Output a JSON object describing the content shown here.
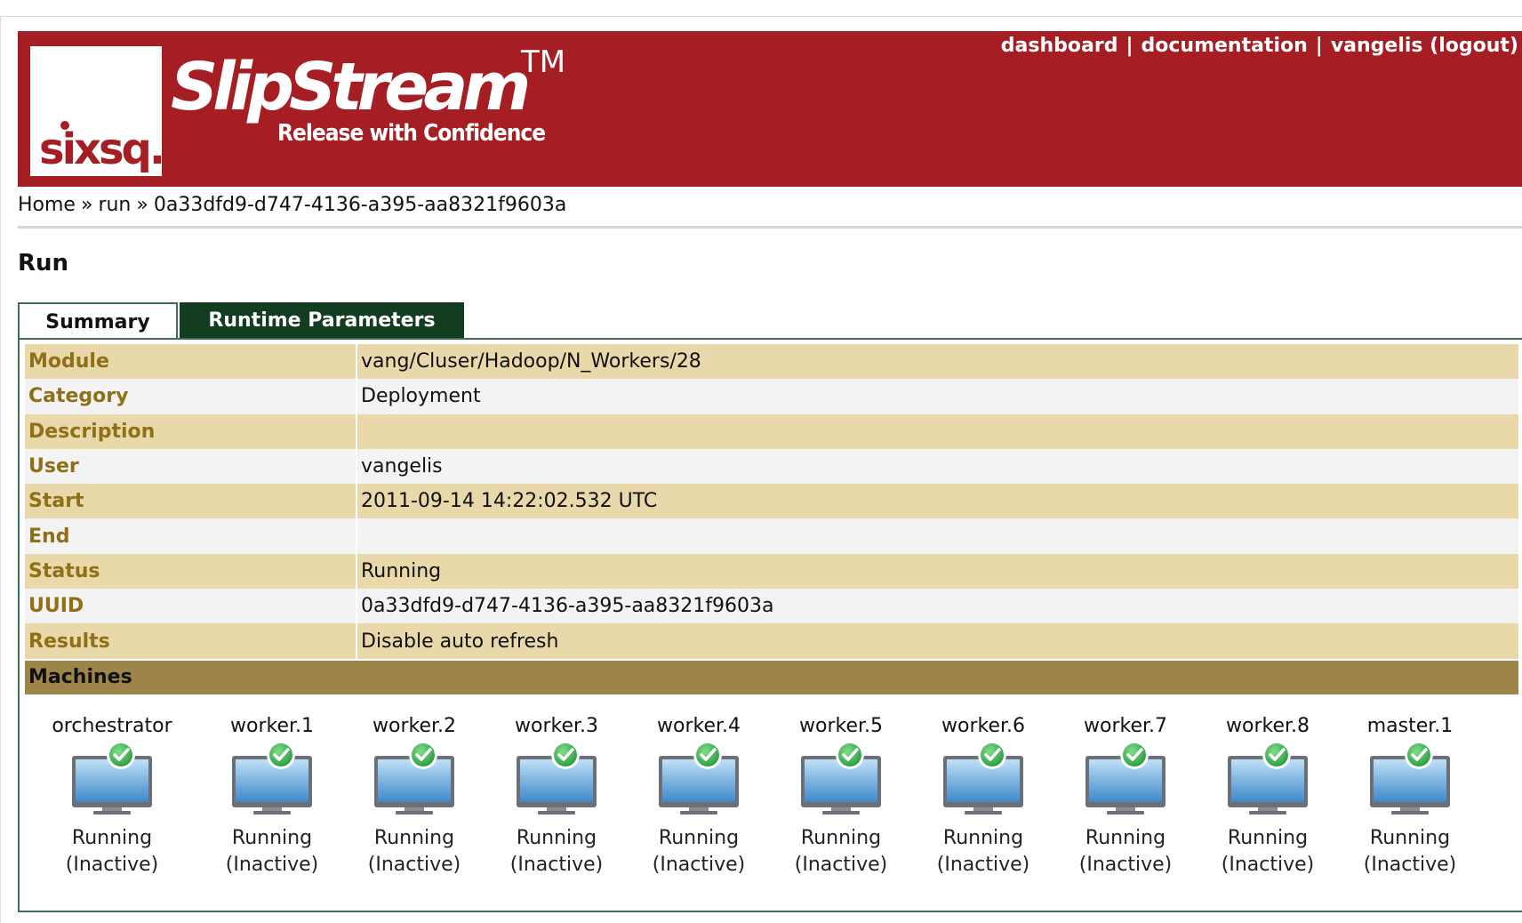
{
  "header": {
    "logo_text": "sixsq.",
    "brand": "SlipStream",
    "trademark": "TM",
    "tagline": "Release with Confidence",
    "nav": {
      "dashboard": "dashboard",
      "separator": "|",
      "documentation": "documentation",
      "user": "vangelis (logout)"
    }
  },
  "breadcrumb": {
    "home": "Home",
    "separator": "»",
    "run": "run",
    "current": "0a33dfd9-d747-4136-a395-aa8321f9603a"
  },
  "page_title": "Run",
  "tabs": {
    "summary": "Summary",
    "runtime": "Runtime Parameters"
  },
  "summary": {
    "module": {
      "label": "Module",
      "value": "vang/Cluser/Hadoop/N_Workers/28"
    },
    "category": {
      "label": "Category",
      "value": "Deployment"
    },
    "description": {
      "label": "Description",
      "value": ""
    },
    "user": {
      "label": "User",
      "value": "vangelis"
    },
    "start": {
      "label": "Start",
      "value": "2011-09-14 14:22:02.532 UTC"
    },
    "end": {
      "label": "End",
      "value": ""
    },
    "status": {
      "label": "Status",
      "value": "Running"
    },
    "uuid": {
      "label": "UUID",
      "value": "0a33dfd9-d747-4136-a395-aa8321f9603a"
    },
    "results": {
      "label": "Results",
      "value": "Disable auto refresh"
    }
  },
  "machines_header": "Machines",
  "machines": [
    {
      "name": "orchestrator",
      "state": "Running",
      "activity": "(Inactive)"
    },
    {
      "name": "worker.1",
      "state": "Running",
      "activity": "(Inactive)"
    },
    {
      "name": "worker.2",
      "state": "Running",
      "activity": "(Inactive)"
    },
    {
      "name": "worker.3",
      "state": "Running",
      "activity": "(Inactive)"
    },
    {
      "name": "worker.4",
      "state": "Running",
      "activity": "(Inactive)"
    },
    {
      "name": "worker.5",
      "state": "Running",
      "activity": "(Inactive)"
    },
    {
      "name": "worker.6",
      "state": "Running",
      "activity": "(Inactive)"
    },
    {
      "name": "worker.7",
      "state": "Running",
      "activity": "(Inactive)"
    },
    {
      "name": "worker.8",
      "state": "Running",
      "activity": "(Inactive)"
    },
    {
      "name": "master.1",
      "state": "Running",
      "activity": "(Inactive)"
    }
  ],
  "colors": {
    "header_red": "#a51e24",
    "tab_dark_green": "#133d20",
    "row_tan": "#e9d8a9",
    "label_gold": "#8f6f18",
    "machines_bar": "#9d8448",
    "check_green": "#3cb54a"
  }
}
